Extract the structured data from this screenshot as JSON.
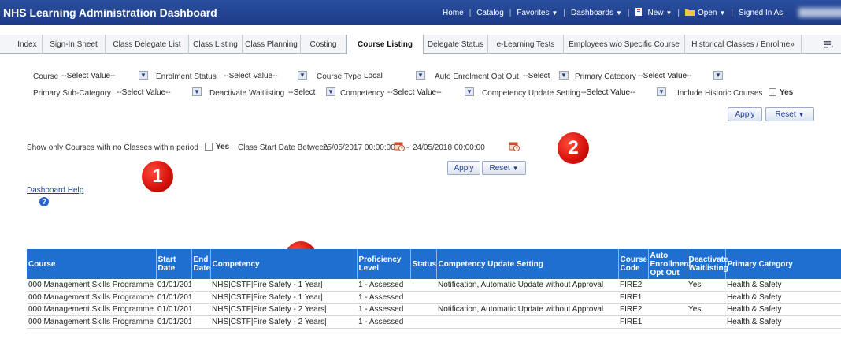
{
  "app_title": "NHS Learning Administration Dashboard",
  "topnav": {
    "home": "Home",
    "catalog": "Catalog",
    "favorites": "Favorites",
    "dashboards": "Dashboards",
    "new": "New",
    "open": "Open",
    "signed_in_as": "Signed In As"
  },
  "tabs": [
    {
      "label": "Index"
    },
    {
      "label": "Sign-In Sheet"
    },
    {
      "label": "Class Delegate List"
    },
    {
      "label": "Class Listing"
    },
    {
      "label": "Class Planning"
    },
    {
      "label": "Costing"
    },
    {
      "label": "Course Listing",
      "active": true
    },
    {
      "label": "Delegate Status"
    },
    {
      "label": "e-Learning Tests"
    },
    {
      "label": "Employees w/o Specific Course"
    },
    {
      "label": "Historical Classes / Enrolme»"
    }
  ],
  "prompts": {
    "course": {
      "label": "Course",
      "value": "--Select Value--"
    },
    "enrolment_status": {
      "label": "Enrolment Status",
      "value": "--Select Value--"
    },
    "course_type": {
      "label": "Course Type",
      "value": "Local"
    },
    "auto_enrolment_opt_out": {
      "label": "Auto Enrolment Opt Out",
      "value": "--Select"
    },
    "primary_category": {
      "label": "Primary Category",
      "value": "--Select Value--"
    },
    "primary_sub_category": {
      "label": "Primary Sub-Category",
      "value": "--Select Value--"
    },
    "deactivate_waitlisting": {
      "label": "Deactivate Waitlisting",
      "value": "--Select"
    },
    "competency": {
      "label": "Competency",
      "value": "--Select Value--"
    },
    "competency_update_setting": {
      "label": "Competency Update Setting",
      "value": "--Select Value--"
    },
    "include_historic": {
      "label": "Include Historic Courses",
      "option": "Yes"
    },
    "apply": "Apply",
    "reset": "Reset"
  },
  "period_prompt": {
    "no_classes_label": "Show only Courses with no Classes within period",
    "no_classes_option": "Yes",
    "date_label": "Class Start Date Between",
    "start": "25/05/2017 00:00:00",
    "dash": "-",
    "end": "24/05/2018 00:00:00",
    "apply": "Apply",
    "reset": "Reset"
  },
  "markers": [
    "1",
    "2",
    "3"
  ],
  "help": {
    "link": "Dashboard Help",
    "icon": "?"
  },
  "table": {
    "headers": [
      "Course",
      "Start Date",
      "End Date",
      "Competency",
      "Proficiency Level",
      "Status",
      "Competency Update Setting",
      "Course Code",
      "Auto Enrollment Opt Out",
      "Deactivate Waitlisting",
      "Primary Category"
    ],
    "rows": [
      [
        "000 Management Skills Programme",
        "01/01/2010",
        "",
        "NHS|CSTF|Fire Safety - 1 Year|",
        "1 - Assessed",
        "",
        "Notification, Automatic Update without Approval",
        "FIRE2",
        "",
        "Yes",
        "Health & Safety"
      ],
      [
        "000 Management Skills Programme",
        "01/01/2010",
        "",
        "NHS|CSTF|Fire Safety - 1 Year|",
        "1 - Assessed",
        "",
        "",
        "FIRE1",
        "",
        "",
        "Health & Safety"
      ],
      [
        "000 Management Skills Programme",
        "01/01/2010",
        "",
        "NHS|CSTF|Fire Safety - 2 Years|",
        "1 - Assessed",
        "",
        "Notification, Automatic Update without Approval",
        "FIRE2",
        "",
        "Yes",
        "Health & Safety"
      ],
      [
        "000 Management Skills Programme",
        "01/01/2010",
        "",
        "NHS|CSTF|Fire Safety - 2 Years|",
        "1 - Assessed",
        "",
        "",
        "FIRE1",
        "",
        "",
        "Health & Safety"
      ]
    ]
  },
  "colors": {
    "header_bar": "#1f3f8f",
    "table_header": "#1f6fd1",
    "marker": "#d4100a",
    "link": "#1d3f8f"
  }
}
